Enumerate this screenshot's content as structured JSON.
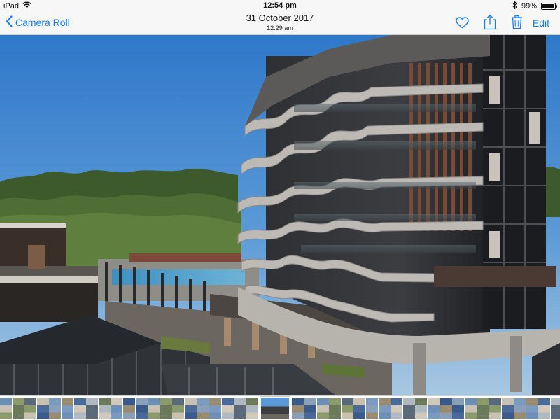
{
  "status_bar": {
    "device": "iPad",
    "time": "12:54 pm",
    "battery_percent": "99%",
    "battery_level": 0.99
  },
  "nav": {
    "back_label": "Camera Roll",
    "title": "31 October 2017",
    "subtitle": "12:29 am",
    "edit_label": "Edit",
    "accent_color": "#1a7df4"
  },
  "photo": {
    "description_icon": "photo-image"
  },
  "thumbnails": {
    "count_before_selected": 21,
    "count_after_selected": 24,
    "palette": [
      "#6b8fb5",
      "#8a9a6a",
      "#5a6a7a",
      "#c8c0b0",
      "#7a9ac0",
      "#9a8a70",
      "#4a6a9a",
      "#b0b8c0",
      "#6a7a5a",
      "#d0c8b8",
      "#3a5a8a",
      "#8aa0b8"
    ]
  }
}
